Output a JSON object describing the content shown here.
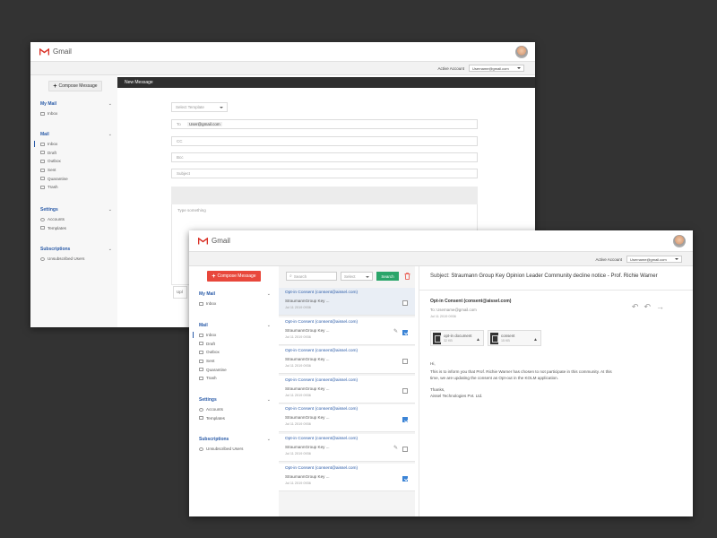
{
  "app_name": "Gmail",
  "account": {
    "label": "Active Account",
    "value": "Username@gmail.com"
  },
  "compose_label": "Compose Message",
  "sidebar": {
    "my_mail": {
      "title": "My Mail",
      "items": [
        "Inbox"
      ]
    },
    "mail": {
      "title": "Mail",
      "items": [
        "Inbox",
        "Draft",
        "Outbox",
        "Sent",
        "Quarantine",
        "Trash"
      ]
    },
    "settings": {
      "title": "Settings",
      "items": [
        "Accounts",
        "Templates"
      ]
    },
    "subscriptions": {
      "title": "Subscriptions",
      "items": [
        "Unsubscribed Users"
      ]
    }
  },
  "compose_window": {
    "header": "New Message",
    "template_placeholder": "Select Template",
    "to_label": "To",
    "to_value": "User@gmail.com",
    "cc_placeholder": "CC",
    "bcc_placeholder": "Bcc",
    "subject_placeholder": "Subject",
    "body_placeholder": "Type something",
    "bottom_button": "Upl"
  },
  "list": {
    "search_placeholder": "Search",
    "select_placeholder": "Select",
    "search_button": "Search",
    "items": [
      {
        "from": "Opt-in Consent (consent@aissel.com)",
        "subject": "StraumannGroup Key ...",
        "date": "Jul 11 2019 0936",
        "checked": false,
        "attachment": false,
        "selected": true
      },
      {
        "from": "Opt-in Consent (consent@aissel.com)",
        "subject": "StraumannGroup Key ...",
        "date": "Jul 11 2019 0936",
        "checked": true,
        "attachment": true,
        "selected": false
      },
      {
        "from": "Opt-in Consent (consent@aissel.com)",
        "subject": "StraumannGroup Key ...",
        "date": "Jul 11 2019 0936",
        "checked": false,
        "attachment": false,
        "selected": false
      },
      {
        "from": "Opt-in Consent (consent@aissel.com)",
        "subject": "StraumannGroup Key ...",
        "date": "Jul 11 2019 0936",
        "checked": false,
        "attachment": false,
        "selected": false
      },
      {
        "from": "Opt-in Consent (consent@aissel.com)",
        "subject": "StraumannGroup Key ...",
        "date": "Jul 11 2019 0936",
        "checked": true,
        "attachment": false,
        "selected": false
      },
      {
        "from": "Opt-in Consent (consent@aissel.com)",
        "subject": "StraumannGroup Key ...",
        "date": "Jul 11 2019 0936",
        "checked": false,
        "attachment": true,
        "selected": false
      },
      {
        "from": "Opt-in Consent (consent@aissel.com)",
        "subject": "StraumannGroup Key ...",
        "date": "Jul 11 2019 0936",
        "checked": true,
        "attachment": false,
        "selected": false
      }
    ]
  },
  "reader": {
    "subject_prefix": "Subject:",
    "subject": "Straumann Group Key Opinion Leader Community decline notice - Prof. Richie Warner",
    "from": "Opt-in Consent (consent@aissel.com)",
    "to": "To:  Username@gmail.com",
    "date": "Jul 11 2019 0936",
    "attachments": [
      {
        "name": "opt-in document",
        "size": "32 KB"
      },
      {
        "name": "consent",
        "size": "15 KB"
      }
    ],
    "greeting": "Hi,",
    "body_line1": "This is to inform you that Prof. Richie Warner has chosen to not participate in this community. At this",
    "body_line2": "time, we are updating the consent as Opt-out in the KOLM application.",
    "closing": "Thanks,",
    "signature": "Aissel Technologies Pvt. Ltd."
  },
  "colors": {
    "accent": "#2a5ba8",
    "compose_red": "#e8473b",
    "search_green": "#2aa56a",
    "gmail_red": "#d93025"
  }
}
